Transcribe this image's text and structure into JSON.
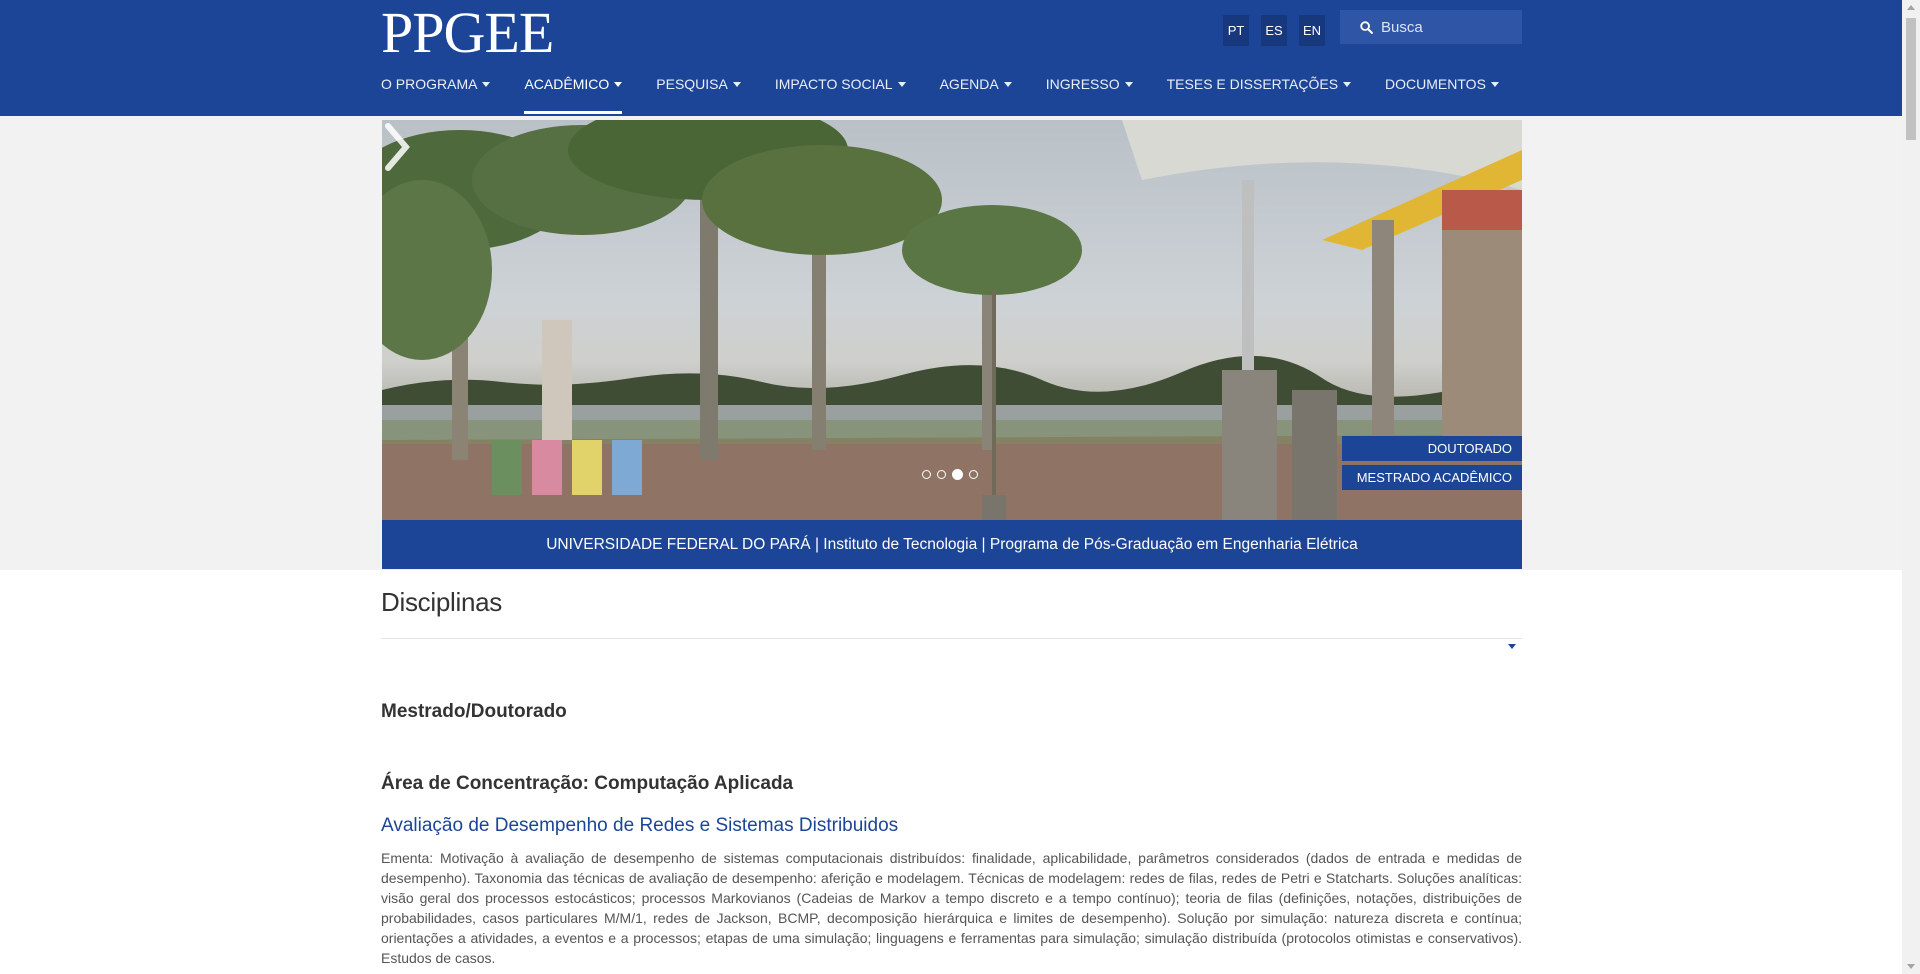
{
  "brand": {
    "logo_text": "PPGEE"
  },
  "languages": [
    {
      "code": "PT"
    },
    {
      "code": "ES"
    },
    {
      "code": "EN"
    }
  ],
  "search": {
    "placeholder": "Busca",
    "icon": "search-icon"
  },
  "nav": {
    "active_index": 1,
    "items": [
      {
        "label": "O PROGRAMA"
      },
      {
        "label": "ACADÊMICO"
      },
      {
        "label": "PESQUISA"
      },
      {
        "label": "IMPACTO SOCIAL"
      },
      {
        "label": "AGENDA"
      },
      {
        "label": "INGRESSO"
      },
      {
        "label": "TESES E DISSERTAÇÕES"
      },
      {
        "label": "DOCUMENTOS"
      }
    ]
  },
  "carousel": {
    "slide_count": 4,
    "active_slide": 3,
    "tabs": [
      {
        "label": "DOUTORADO"
      },
      {
        "label": "MESTRADO ACADÊMICO"
      }
    ],
    "caption": "UNIVERSIDADE FEDERAL DO PARÁ | Instituto de Tecnologia | Programa de Pós-Graduação em Engenharia Elétrica"
  },
  "content": {
    "page_title": "Disciplinas",
    "section_title": "Mestrado/Doutorado",
    "area_title": "Área de Concentração: Computação Aplicada",
    "course": {
      "title": "Avaliação de Desempenho de Redes e Sistemas Distribuidos",
      "ementa": "Ementa: Motivação à avaliação de desempenho de sistemas computacionais distribuídos: finalidade, aplicabilidade, parâmetros considerados (dados de entrada e medidas de desempenho). Taxonomia das técnicas de avaliação de desempenho: aferição e modelagem. Técnicas de modelagem: redes de filas, redes de Petri e Statcharts. Soluções analíticas: visão geral dos processos estocásticos; processos Markovianos (Cadeias de Markov a tempo discreto e a tempo contínuo); teoria de filas (definições, notações, distribuições de probabilidades, casos particulares M/M/1, redes de Jackson, BCMP, decomposição hierárquica e limites de desempenho). Solução por simulação: natureza discreta e contínua; orientações a atividades, a eventos e a processos; etapas de uma simulação; linguagens e ferramentas para simulação; simulação distribuída (protocolos otimistas e conservativos). Estudos de casos."
    }
  },
  "colors": {
    "primary": "#1d4597",
    "dark": "#17387c",
    "banner_bg": "#f2f2f2"
  }
}
